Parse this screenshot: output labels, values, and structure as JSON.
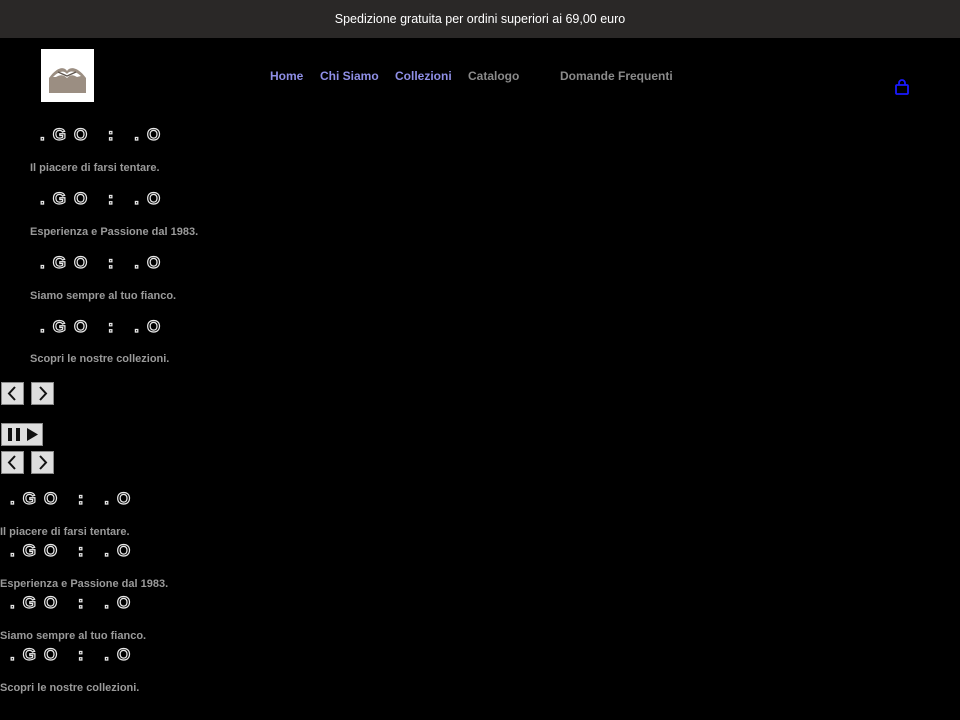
{
  "announcement": {
    "text": "Spedizione gratuita per ordini superiori ai 69,00 euro"
  },
  "header": {
    "logo_icon": "brand-logo-icon",
    "nav": [
      {
        "label": "Home"
      },
      {
        "label": "Chi Siamo"
      },
      {
        "label": "Collezioni"
      },
      {
        "label": "Catalogo"
      },
      {
        "label": "Domande Frequenti"
      }
    ],
    "cart_icon": "shopping-bag-icon"
  },
  "slideshow": {
    "slides": [
      {
        "wordmark": ".GO : .O",
        "caption": "Il piacere di farsi tentare."
      },
      {
        "wordmark": ".GO : .O",
        "caption": "Esperienza e Passione dal 1983."
      },
      {
        "wordmark": ".GO : .O",
        "caption": "Siamo sempre al tuo fianco."
      },
      {
        "wordmark": ".GO : .O",
        "caption": "Scopri le nostre collezioni."
      }
    ],
    "controls": {
      "prev_icon": "chevron-left-icon",
      "next_icon": "chevron-right-icon",
      "pause_icon": "pause-icon",
      "play_icon": "play-icon"
    }
  },
  "slideshow_secondary": {
    "slides": [
      {
        "wordmark": ".GO : .O",
        "caption": "Il piacere di farsi tentare."
      },
      {
        "wordmark": ".GO : .O",
        "caption": "Esperienza e Passione dal 1983."
      },
      {
        "wordmark": ".GO : .O",
        "caption": "Siamo sempre al tuo fianco."
      },
      {
        "wordmark": ".GO : .O",
        "caption": "Scopri le nostre collezioni."
      }
    ]
  },
  "colors": {
    "page_background": "#000000",
    "announcement_bar": "#2a2827",
    "visited_link": "#8f8fe6",
    "cart_icon": "#1a1aff",
    "logo_mark": "#9b8e82"
  }
}
